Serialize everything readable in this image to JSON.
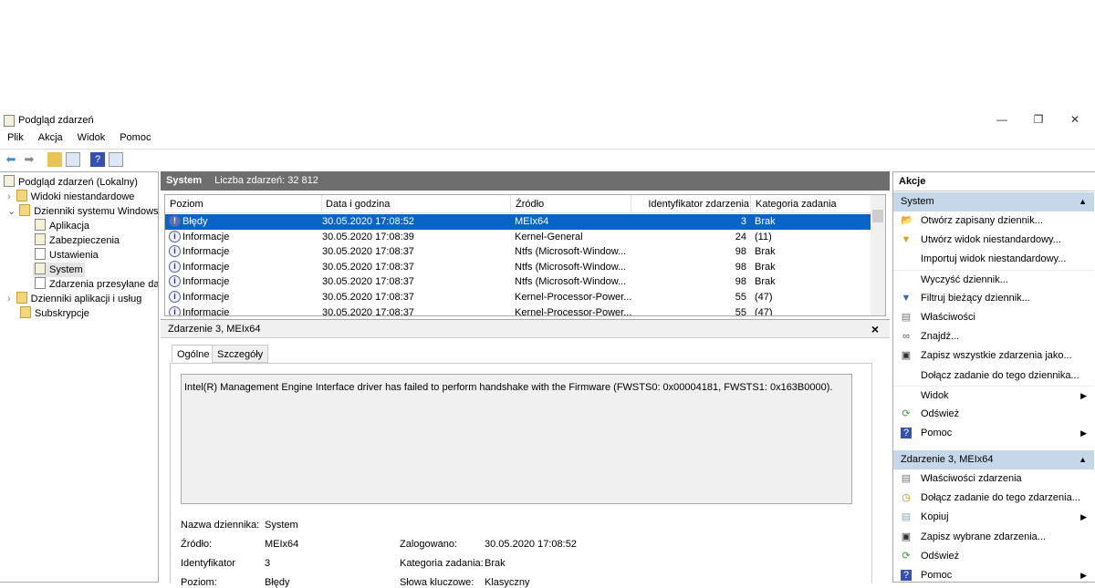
{
  "window": {
    "title": "Podgląd zdarzeń",
    "minimize": "—",
    "maximize": "❐",
    "close": "✕"
  },
  "menu": [
    "Plik",
    "Akcja",
    "Widok",
    "Pomoc"
  ],
  "tree": {
    "root": "Podgląd zdarzeń (Lokalny)",
    "custom": "Widoki niestandardowe",
    "winlogs": "Dzienniki systemu Windows",
    "app": "Aplikacja",
    "sec": "Zabezpieczenia",
    "setup": "Ustawienia",
    "system": "System",
    "fwd": "Zdarzenia przesyłane dale",
    "applogs": "Dzienniki aplikacji i usług",
    "subs": "Subskrypcje"
  },
  "header": {
    "name": "System",
    "count": "Liczba zdarzeń: 32 812"
  },
  "table": {
    "columns": [
      "Poziom",
      "Data i godzina",
      "Źródło",
      "Identyfikator zdarzenia",
      "Kategoria zadania"
    ],
    "rows": [
      [
        "Błędy",
        "30.05.2020 17:08:52",
        "MEIx64",
        "3",
        "Brak"
      ],
      [
        "Informacje",
        "30.05.2020 17:08:39",
        "Kernel-General",
        "24",
        "(11)"
      ],
      [
        "Informacje",
        "30.05.2020 17:08:37",
        "Ntfs (Microsoft-Window...",
        "98",
        "Brak"
      ],
      [
        "Informacje",
        "30.05.2020 17:08:37",
        "Ntfs (Microsoft-Window...",
        "98",
        "Brak"
      ],
      [
        "Informacje",
        "30.05.2020 17:08:37",
        "Ntfs (Microsoft-Window...",
        "98",
        "Brak"
      ],
      [
        "Informacje",
        "30.05.2020 17:08:37",
        "Kernel-Processor-Power...",
        "55",
        "(47)"
      ],
      [
        "Informacje",
        "30.05.2020 17:08:37",
        "Kernel-Processor-Power...",
        "55",
        "(47)"
      ]
    ]
  },
  "detail": {
    "title": "Zdarzenie 3, MEIx64",
    "close": "×",
    "tabs": [
      "Ogólne",
      "Szczegóły"
    ],
    "message": "Intel(R) Management Engine Interface driver has failed to perform handshake with the Firmware (FWSTS0: 0x00004181, FWSTS1: 0x163B0000).",
    "fields": {
      "log_label": "Nazwa dziennika:",
      "log": "System",
      "src_label": "Źródło:",
      "src": "MEIx64",
      "logged_label": "Zalogowano:",
      "logged": "30.05.2020 17:08:52",
      "id_label": "Identyfikator",
      "id": "3",
      "cat_label": "Kategoria zadania:",
      "cat": "Brak",
      "level_label": "Poziom:",
      "level": "Błędy",
      "kw_label": "Słowa kluczowe:",
      "kw": "Klasyczny"
    }
  },
  "actions": {
    "title": "Akcje",
    "sec1": "System",
    "items1": [
      "Otwórz zapisany dziennik...",
      "Utwórz widok niestandardowy...",
      "Importuj widok niestandardowy...",
      "Wyczyść dziennik...",
      "Filtruj bieżący dziennik...",
      "Właściwości",
      "Znajdź...",
      "Zapisz wszystkie zdarzenia jako...",
      "Dołącz zadanie do tego dziennika...",
      "Widok",
      "Odśwież",
      "Pomoc"
    ],
    "sec2": "Zdarzenie 3, MEIx64",
    "items2": [
      "Właściwości zdarzenia",
      "Dołącz zadanie do tego zdarzenia...",
      "Kopiuj",
      "Zapisz wybrane zdarzenia...",
      "Odśwież",
      "Pomoc"
    ]
  },
  "colors": {
    "selection": "#0a64c8",
    "header": "#6e6e6e",
    "section": "#c6d7ea"
  }
}
